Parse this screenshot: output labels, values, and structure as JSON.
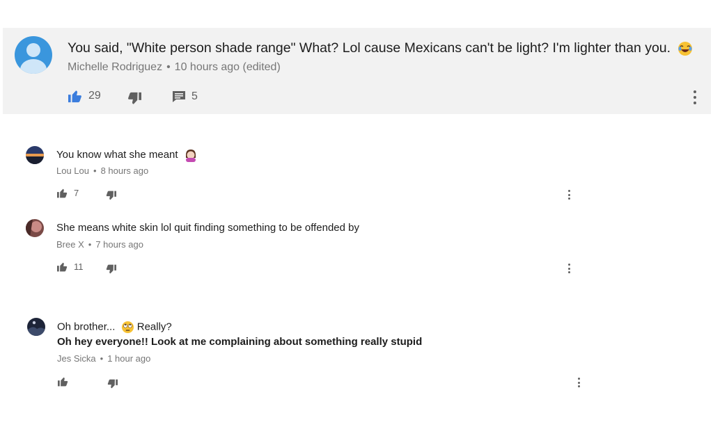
{
  "top_comment": {
    "text": "You said, \"White person shade range\" What? Lol cause Mexicans can't be light? I'm lighter than you.",
    "emoji": "face-with-tears-of-joy",
    "author": "Michelle Rodriguez",
    "time": "10 hours ago (edited)",
    "likes": "29",
    "replies_count": "5",
    "like_color": "#3b7ddd"
  },
  "replies": [
    {
      "text": "You know what she meant",
      "emoji": "person-facepalming",
      "author": "Lou Lou",
      "time": "8 hours ago",
      "likes": "7"
    },
    {
      "text": "She means white skin lol quit finding something to be offended by",
      "author": "Bree X",
      "time": "7 hours ago",
      "likes": "11"
    },
    {
      "text_line1": "Oh brother...",
      "text_line1_end": "Really?",
      "emoji": "face-with-rolling-eyes",
      "text_line2": "Oh hey everyone!! Look at me complaining about something really stupid",
      "author": "Jes Sicka",
      "time": "1 hour ago",
      "likes": ""
    }
  ],
  "separator": "•"
}
